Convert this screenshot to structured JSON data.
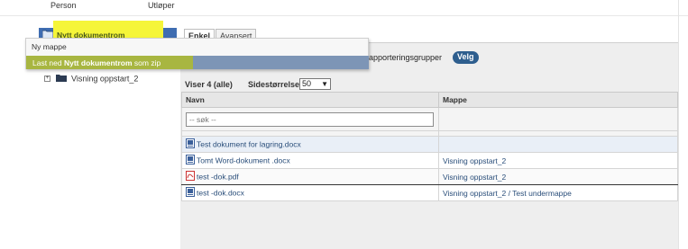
{
  "top": {
    "col_person": "Person",
    "col_utloper": "Utløper"
  },
  "tree": {
    "header_title": "Nytt dokumentrom",
    "items": [
      {
        "label": "Visning oppstart_2"
      }
    ]
  },
  "context_menu": {
    "item_new_folder": "Ny mappe",
    "item_download_prefix": "Last ned ",
    "item_download_bold": "Nytt dokumentrom",
    "item_download_suffix": " som zip"
  },
  "tabs": [
    {
      "label": "Enkel"
    },
    {
      "label": "Avansert"
    }
  ],
  "reports": {
    "label": "apporteringsgrupper",
    "button": "Velg"
  },
  "list": {
    "count_label": "Viser 4 (alle)",
    "page_size_label": "Sidestørrelse",
    "page_size_value": "50",
    "columns": {
      "name": "Navn",
      "folder": "Mappe"
    },
    "search_placeholder": "-- søk --",
    "rows": [
      {
        "name": "Test dokument for lagring.docx",
        "folder": "",
        "icon": "word-doc-icon"
      },
      {
        "name": "Tomt Word-dokument .docx",
        "folder": "Visning oppstart_2",
        "icon": "word-doc-icon"
      },
      {
        "name": "test -dok.pdf",
        "folder": "Visning oppstart_2",
        "icon": "pdf-icon"
      },
      {
        "name": "test -dok.docx",
        "folder": "Visning oppstart_2 / Test undermappe",
        "icon": "word-doc-icon"
      }
    ]
  },
  "colors": {
    "highlight": "#f5f539",
    "header_blue": "#3f6db1",
    "velg_button": "#2e5e8e",
    "link": "#2a4e7a"
  }
}
